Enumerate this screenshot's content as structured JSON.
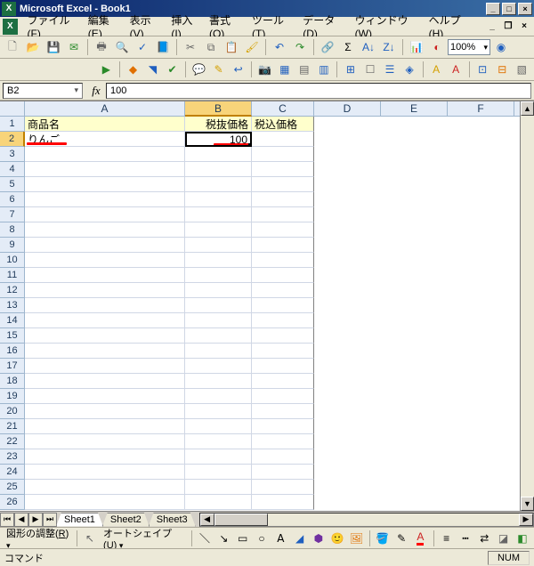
{
  "title": "Microsoft Excel - Book1",
  "menus": {
    "file": {
      "label": "ファイル",
      "hot": "F"
    },
    "edit": {
      "label": "編集",
      "hot": "E"
    },
    "view": {
      "label": "表示",
      "hot": "V"
    },
    "insert": {
      "label": "挿入",
      "hot": "I"
    },
    "format": {
      "label": "書式",
      "hot": "O"
    },
    "tools": {
      "label": "ツール",
      "hot": "T"
    },
    "data": {
      "label": "データ",
      "hot": "D"
    },
    "window": {
      "label": "ウィンドウ",
      "hot": "W"
    },
    "help": {
      "label": "ヘルプ",
      "hot": "H"
    }
  },
  "help_placeholder": "",
  "zoom": "100%",
  "namebox": "B2",
  "formula": "100",
  "columns": [
    "A",
    "B",
    "C",
    "D",
    "E",
    "F"
  ],
  "rows_visible": 26,
  "selection": {
    "row": 2,
    "col": "B"
  },
  "headers": {
    "A1": "商品名",
    "B1": "税抜価格",
    "C1": "税込価格"
  },
  "cells": {
    "A2": "りんご",
    "B2": "100"
  },
  "sheets": [
    "Sheet1",
    "Sheet2",
    "Sheet3"
  ],
  "active_sheet": 0,
  "drawbar": {
    "adjust": "図形の調整",
    "adjust_hot": "R",
    "autoshape": "オートシェイプ",
    "autoshape_hot": "U"
  },
  "status": {
    "mode": "コマンド",
    "num": "NUM"
  }
}
